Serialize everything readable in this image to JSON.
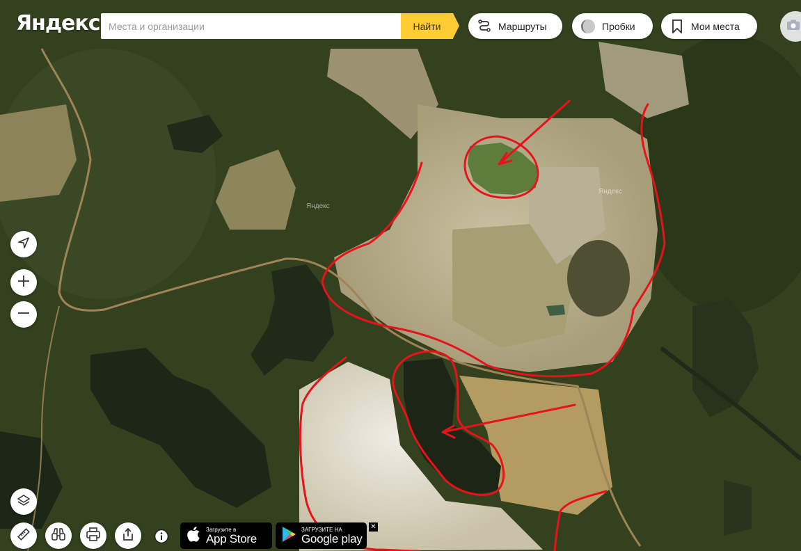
{
  "brand": {
    "logo_text": "Яндекс"
  },
  "search": {
    "placeholder": "Места и организации",
    "value": "",
    "button_label": "Найти"
  },
  "top_controls": [
    {
      "id": "routes",
      "label": "Маршруты",
      "icon": "route-icon"
    },
    {
      "id": "traffic",
      "label": "Пробки",
      "icon": "traffic-icon"
    },
    {
      "id": "places",
      "label": "Мои места",
      "icon": "bookmark-icon"
    }
  ],
  "map": {
    "layer": "satellite",
    "watermarks": [
      "Яндекс",
      "Яндекс"
    ],
    "annotation_color": "#e8121a",
    "colors": {
      "forest": "#34411f",
      "bare_ground": "#bcb394",
      "water": "#1f2a19",
      "road": "#a08456"
    }
  },
  "map_controls": {
    "left": [
      "locate-icon",
      "zoom-in-icon",
      "zoom-out-icon",
      "layers-icon"
    ],
    "bottom": [
      "ruler-icon",
      "panorama-icon",
      "print-icon",
      "share-icon",
      "info-icon"
    ]
  },
  "app_badges": {
    "apple": {
      "small": "Загрузите в",
      "big": "App Store"
    },
    "google": {
      "small": "ЗАГРУЗИТЕ НА",
      "big": "Google play"
    },
    "close": "✕"
  }
}
